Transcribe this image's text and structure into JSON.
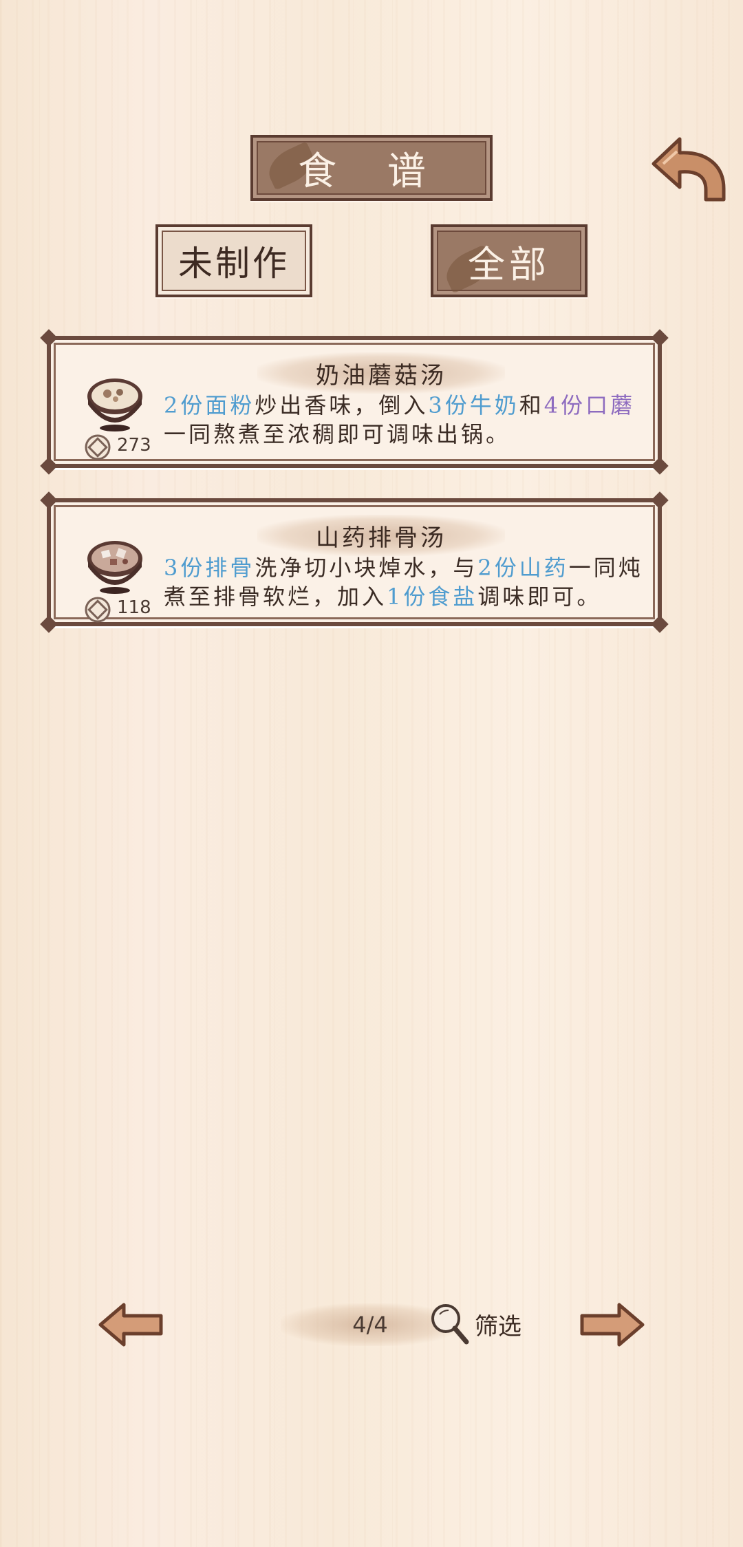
{
  "header": {
    "title": "食 谱",
    "filters": [
      "未制作",
      "全部"
    ]
  },
  "recipes": [
    {
      "name": "奶油蘑菇汤",
      "count": "273",
      "desc_lines": [
        [
          {
            "text": "2份面粉",
            "color": "blue"
          },
          {
            "text": "炒出香味，倒入",
            "color": "plain"
          },
          {
            "text": "3份牛奶",
            "color": "blue"
          },
          {
            "text": "和",
            "color": "plain"
          },
          {
            "text": "4份口蘑",
            "color": "purple"
          }
        ],
        [
          {
            "text": "一同熬煮至浓稠即可调味出锅。",
            "color": "plain"
          }
        ]
      ]
    },
    {
      "name": "山药排骨汤",
      "count": "118",
      "desc_lines": [
        [
          {
            "text": "3份排骨",
            "color": "blue"
          },
          {
            "text": "洗净切小块焯水，与",
            "color": "plain"
          },
          {
            "text": "2份山药",
            "color": "blue"
          },
          {
            "text": "一同炖",
            "color": "plain"
          }
        ],
        [
          {
            "text": "煮至排骨软烂，加入",
            "color": "plain"
          },
          {
            "text": "1份食盐",
            "color": "blue"
          },
          {
            "text": "调味即可。",
            "color": "plain"
          }
        ]
      ]
    }
  ],
  "pagination": {
    "page": "4/4",
    "filter_label": "筛选"
  },
  "colors": {
    "blue": "#4f9ccf",
    "purple": "#8d6bbf",
    "wood_dark": "#5a3b30",
    "wood_plaque": "#9a7965",
    "paper": "#fbf1e7"
  },
  "icons": {
    "back": "back-arrow-icon",
    "prev": "left-arrow-icon",
    "next": "right-arrow-icon",
    "search": "search-icon",
    "coin": "coin-icon",
    "dish": "soup-bowl-icon"
  }
}
